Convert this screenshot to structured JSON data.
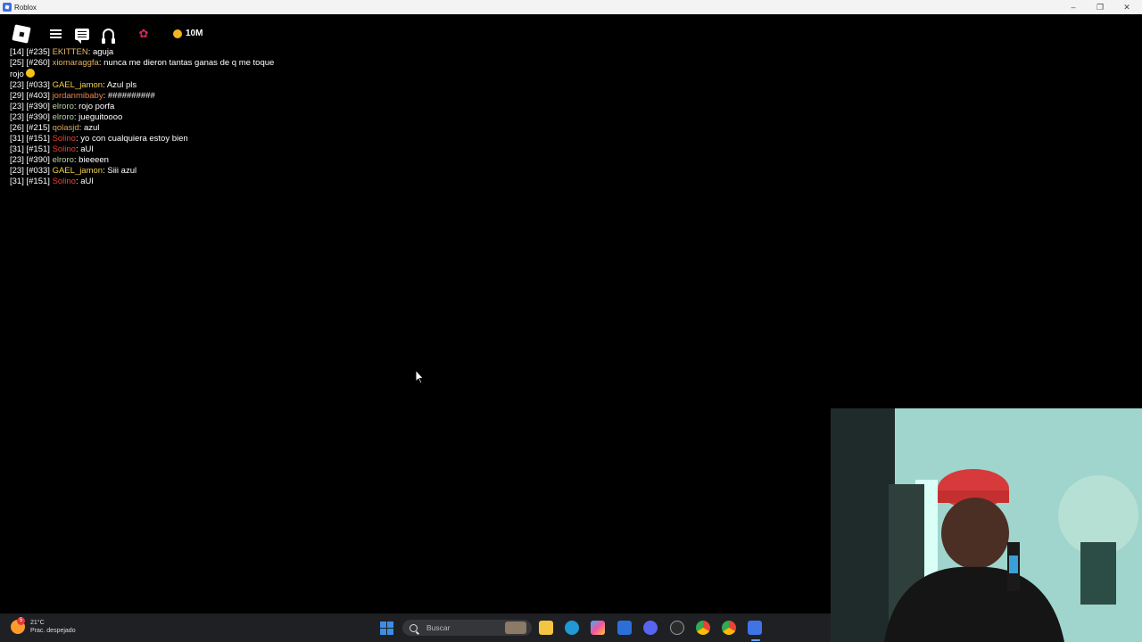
{
  "window": {
    "title": "Roblox"
  },
  "topbar": {
    "robux": "10M"
  },
  "chat": {
    "messages": [
      {
        "level": "[14]",
        "id": "[#235]",
        "user": "EKITTEN",
        "user_color": "#e9b86a",
        "text": "aguja"
      },
      {
        "level": "[25]",
        "id": "[#260]",
        "user": "xiomaraggfa",
        "user_color": "#e0b15a",
        "text": "nunca me dieron tantas ganas de q me toque rojo"
      },
      {
        "level": "[23]",
        "id": "[#033]",
        "user": "GAEL_jamon",
        "user_color": "#f0d24a",
        "text": "Azul pls"
      },
      {
        "level": "[29]",
        "id": "[#403]",
        "user": "jordanmibaby",
        "user_color": "#e8844a",
        "text": "##########"
      },
      {
        "level": "[23]",
        "id": "[#390]",
        "user": "elroro",
        "user_color": "#b9d3a6",
        "text": "rojo porfa"
      },
      {
        "level": "[23]",
        "id": "[#390]",
        "user": "elroro",
        "user_color": "#b9d3a6",
        "text": "jueguitoooo"
      },
      {
        "level": "[26]",
        "id": "[#215]",
        "user": "qolasjd",
        "user_color": "#d9a55a",
        "text": "azul"
      },
      {
        "level": "[31]",
        "id": "[#151]",
        "user": "Solino",
        "user_color": "#e8402f",
        "text": "yo con cualquiera estoy bien"
      },
      {
        "level": "[31]",
        "id": "[#151]",
        "user": "Solino",
        "user_color": "#e8402f",
        "text": "aUl"
      },
      {
        "level": "[23]",
        "id": "[#390]",
        "user": "elroro",
        "user_color": "#b9d3a6",
        "text": "bieeeen"
      },
      {
        "level": "[23]",
        "id": "[#033]",
        "user": "GAEL_jamon",
        "user_color": "#f0d24a",
        "text": "Siii azul"
      },
      {
        "level": "[31]",
        "id": "[#151]",
        "user": "Solino",
        "user_color": "#e8402f",
        "text": "aUl"
      }
    ]
  },
  "taskbar": {
    "weather_temp": "21°C",
    "weather_desc": "Prac. despejado",
    "weather_badge": "5",
    "search_placeholder": "Buscar"
  },
  "icons": {
    "taskbar_apps": [
      "file-explorer-icon",
      "edge-icon",
      "copilot-icon",
      "store-icon",
      "discord-icon",
      "obs-icon",
      "chrome-icon",
      "chrome-icon",
      "roblox-icon"
    ]
  }
}
